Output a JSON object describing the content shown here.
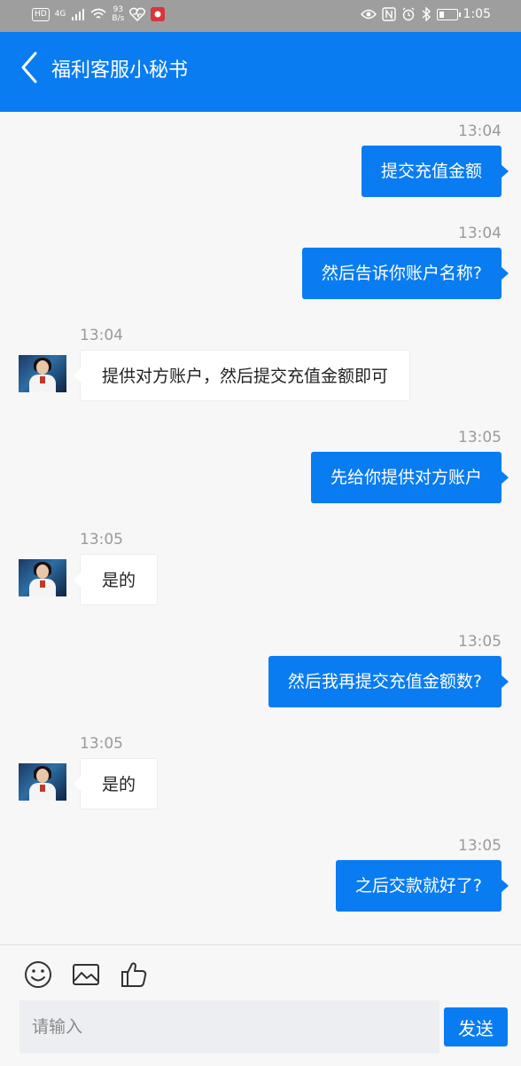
{
  "status_bar": {
    "hd": "HD",
    "net": "4G",
    "speed_value": "93",
    "speed_unit": "B/s",
    "time": "1:05",
    "icons": [
      "signal-icon",
      "wifi-icon",
      "health-icon",
      "app-icon",
      "eye-icon",
      "nfc-icon",
      "alarm-icon",
      "bluetooth-icon",
      "battery-icon"
    ],
    "battery_level": 0.3
  },
  "header": {
    "title": "福利客服小秘书",
    "back_icon": "chevron-left-icon"
  },
  "messages": [
    {
      "direction": "out",
      "time": "13:04",
      "text": "提交充值金额"
    },
    {
      "direction": "out",
      "time": "13:04",
      "text": "然后告诉你账户名称?"
    },
    {
      "direction": "in",
      "time": "13:04",
      "text": "提供对方账户，然后提交充值金额即可"
    },
    {
      "direction": "out",
      "time": "13:05",
      "text": "先给你提供对方账户"
    },
    {
      "direction": "in",
      "time": "13:05",
      "text": "是的"
    },
    {
      "direction": "out",
      "time": "13:05",
      "text": "然后我再提交充值金额数?"
    },
    {
      "direction": "in",
      "time": "13:05",
      "text": "是的"
    },
    {
      "direction": "out",
      "time": "13:05",
      "text": "之后交款就好了?"
    }
  ],
  "composer": {
    "tools": [
      "emoji-icon",
      "image-icon",
      "thumbs-up-icon"
    ],
    "placeholder": "请输入",
    "send_label": "发送"
  },
  "colors": {
    "accent": "#0a7cf2",
    "status_bar": "#9e9e9e",
    "background": "#f7f7f7"
  }
}
